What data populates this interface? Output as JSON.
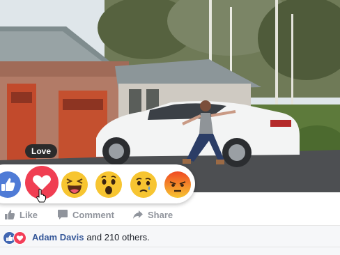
{
  "tooltip": {
    "label": "Love"
  },
  "reactions": [
    {
      "name": "like",
      "color": "#4f7bd6"
    },
    {
      "name": "love",
      "color": "#f03e52"
    },
    {
      "name": "haha",
      "color": "#f7c531"
    },
    {
      "name": "wow",
      "color": "#f7c531"
    },
    {
      "name": "sad",
      "color": "#f7c531"
    },
    {
      "name": "angry",
      "color": "#f36a23"
    }
  ],
  "actions": {
    "like_label": "Like",
    "comment_label": "Comment",
    "share_label": "Share"
  },
  "summary": {
    "name": "Adam Davis",
    "others": "and 210 others."
  },
  "colors": {
    "link": "#365899",
    "action_gray": "#90949c",
    "like_blue": "#4267b2",
    "love_red": "#f33e58"
  }
}
